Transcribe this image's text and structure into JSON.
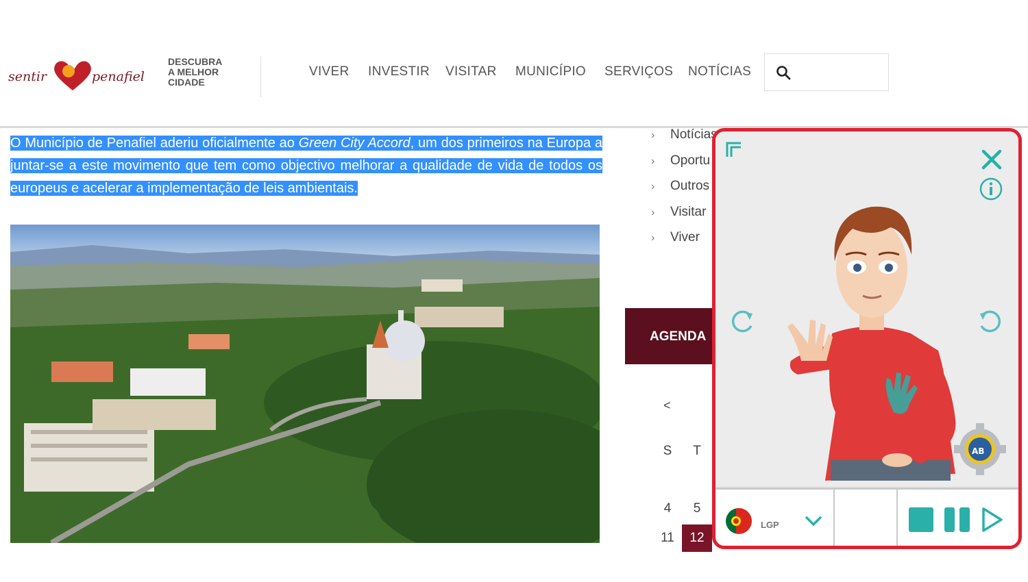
{
  "header": {
    "logo_text": "sentir Penafiel",
    "tagline": [
      "DESCUBRA",
      "A MELHOR",
      "CIDADE"
    ],
    "nav": [
      "VIVER",
      "INVESTIR",
      "VISITAR",
      "MUNICÍPIO",
      "SERVIÇOS",
      "NOTÍCIAS"
    ],
    "search": {
      "icon": "search-icon",
      "value": ""
    }
  },
  "article": {
    "intro_before": "O Município de Penafiel aderiu oficialmente ao ",
    "intro_italic": "Green City Accord",
    "intro_after": ", um dos primeiros na Europa a juntar-se a este movimento que tem como objectivo melhorar a qualidade de vida de todos os europeus e acelerar a implementação de leis ambientais.",
    "selection_color": "#3390ff"
  },
  "sidebar": {
    "items": [
      "Notícias",
      "Oportu",
      "Outros",
      "Visitar",
      "Viver"
    ],
    "agenda_label": "AGENDA",
    "agenda_color": "#5b0f1f"
  },
  "calendar": {
    "prev": "<",
    "weekdays": [
      "S",
      "T"
    ],
    "row1": [
      "4",
      "5"
    ],
    "row2": [
      "11",
      "12"
    ],
    "today": "12",
    "today_color": "#7a1529"
  },
  "sign_widget": {
    "border_color": "#e02030",
    "accent_color": "#2ab0a8",
    "language_code": "LGP",
    "icons": [
      "minimize-icon",
      "close-icon",
      "info-icon",
      "rotate-left-icon",
      "rotate-right-icon",
      "settings-gear-icon",
      "portugal-flag-icon",
      "chevron-down-icon",
      "stop-icon",
      "pause-icon",
      "play-icon"
    ]
  }
}
